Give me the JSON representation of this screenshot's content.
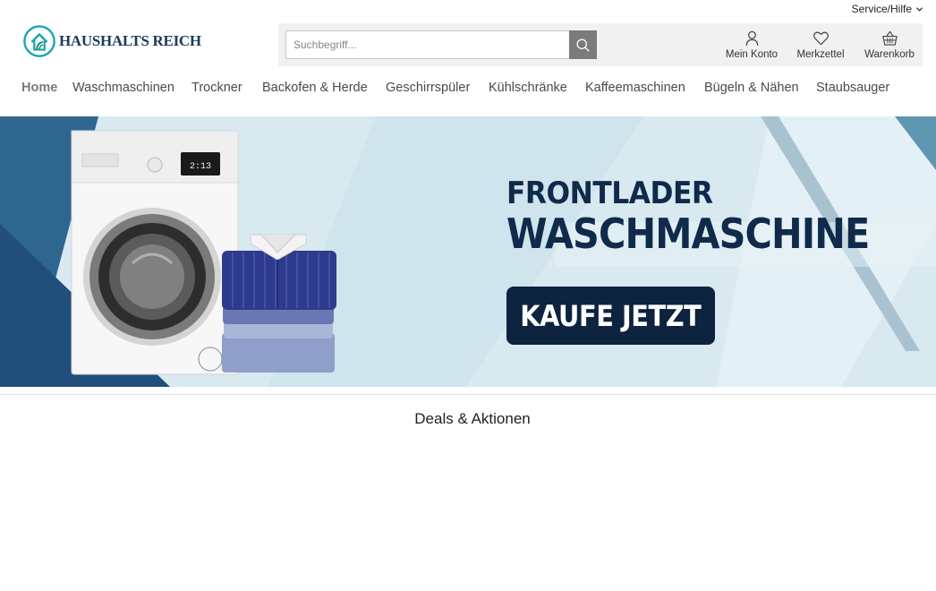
{
  "service": {
    "label": "Service/Hilfe",
    "icon": "chevron-down-icon"
  },
  "logo": {
    "text": "HAUSHALTS REICH",
    "icon": "house-logo-icon"
  },
  "search": {
    "placeholder": "Suchbegriff...",
    "value": "",
    "icon": "search-icon"
  },
  "header_actions": [
    {
      "label": "Mein Konto",
      "icon": "user-icon"
    },
    {
      "label": "Merkzettel",
      "icon": "heart-icon"
    },
    {
      "label": "Warenkorb",
      "icon": "basket-icon"
    }
  ],
  "nav": {
    "items": [
      {
        "label": "Home",
        "active": true
      },
      {
        "label": "Waschmaschinen",
        "active": false
      },
      {
        "label": "Trockner",
        "active": false
      },
      {
        "label": "Backofen & Herde",
        "active": false
      },
      {
        "label": "Geschirrspüler",
        "active": false
      },
      {
        "label": "Kühlschränke",
        "active": false
      },
      {
        "label": "Kaffeemaschinen",
        "active": false
      },
      {
        "label": "Bügeln & Nähen",
        "active": false
      },
      {
        "label": "Staubsauger",
        "active": false
      }
    ]
  },
  "hero": {
    "line1": "FRONTLADER",
    "line2": "WASCHMASCHINE",
    "cta": "KAUFE JETZT",
    "machine_display": "2:13"
  },
  "section": {
    "title": "Deals & Aktionen"
  },
  "colors": {
    "navy": "#0f2a4a",
    "button_navy": "#0d2340",
    "search_button": "#7b7b7b",
    "logo_teal": "#1aa6b4",
    "banner_bg": "#dbeaf0"
  }
}
